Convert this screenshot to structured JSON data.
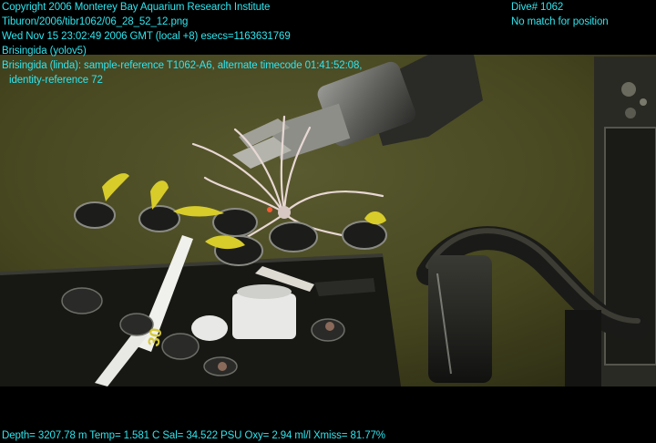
{
  "overlay": {
    "copyright": "Copyright 2006 Monterey Bay Aquarium Research Institute",
    "file_path": "Tiburon/2006/tibr1062/06_28_52_12.png",
    "timestamp": "Wed Nov 15 23:02:49 2006 GMT (local +8)  esecs=1163631769",
    "label_yolo": "Brisingida (yolov5)",
    "label_linda": "Brisingida (linda): sample-reference T1062-A6, alternate timecode 01:41:52:08,",
    "identity_reference": "identity-reference 72",
    "dive": "Dive# 1062",
    "position_status": "No match for position",
    "telemetry": "Depth= 3207.78 m  Temp= 1.581 C  Sal= 34.522 PSU  Oxy= 2.94 ml/l  Xmiss= 81.77%"
  },
  "colors": {
    "overlay_text": "#2fe6ef",
    "seafloor": "#4a4a26",
    "letterbox": "#000000"
  },
  "scene": {
    "tube_marking": "30"
  }
}
